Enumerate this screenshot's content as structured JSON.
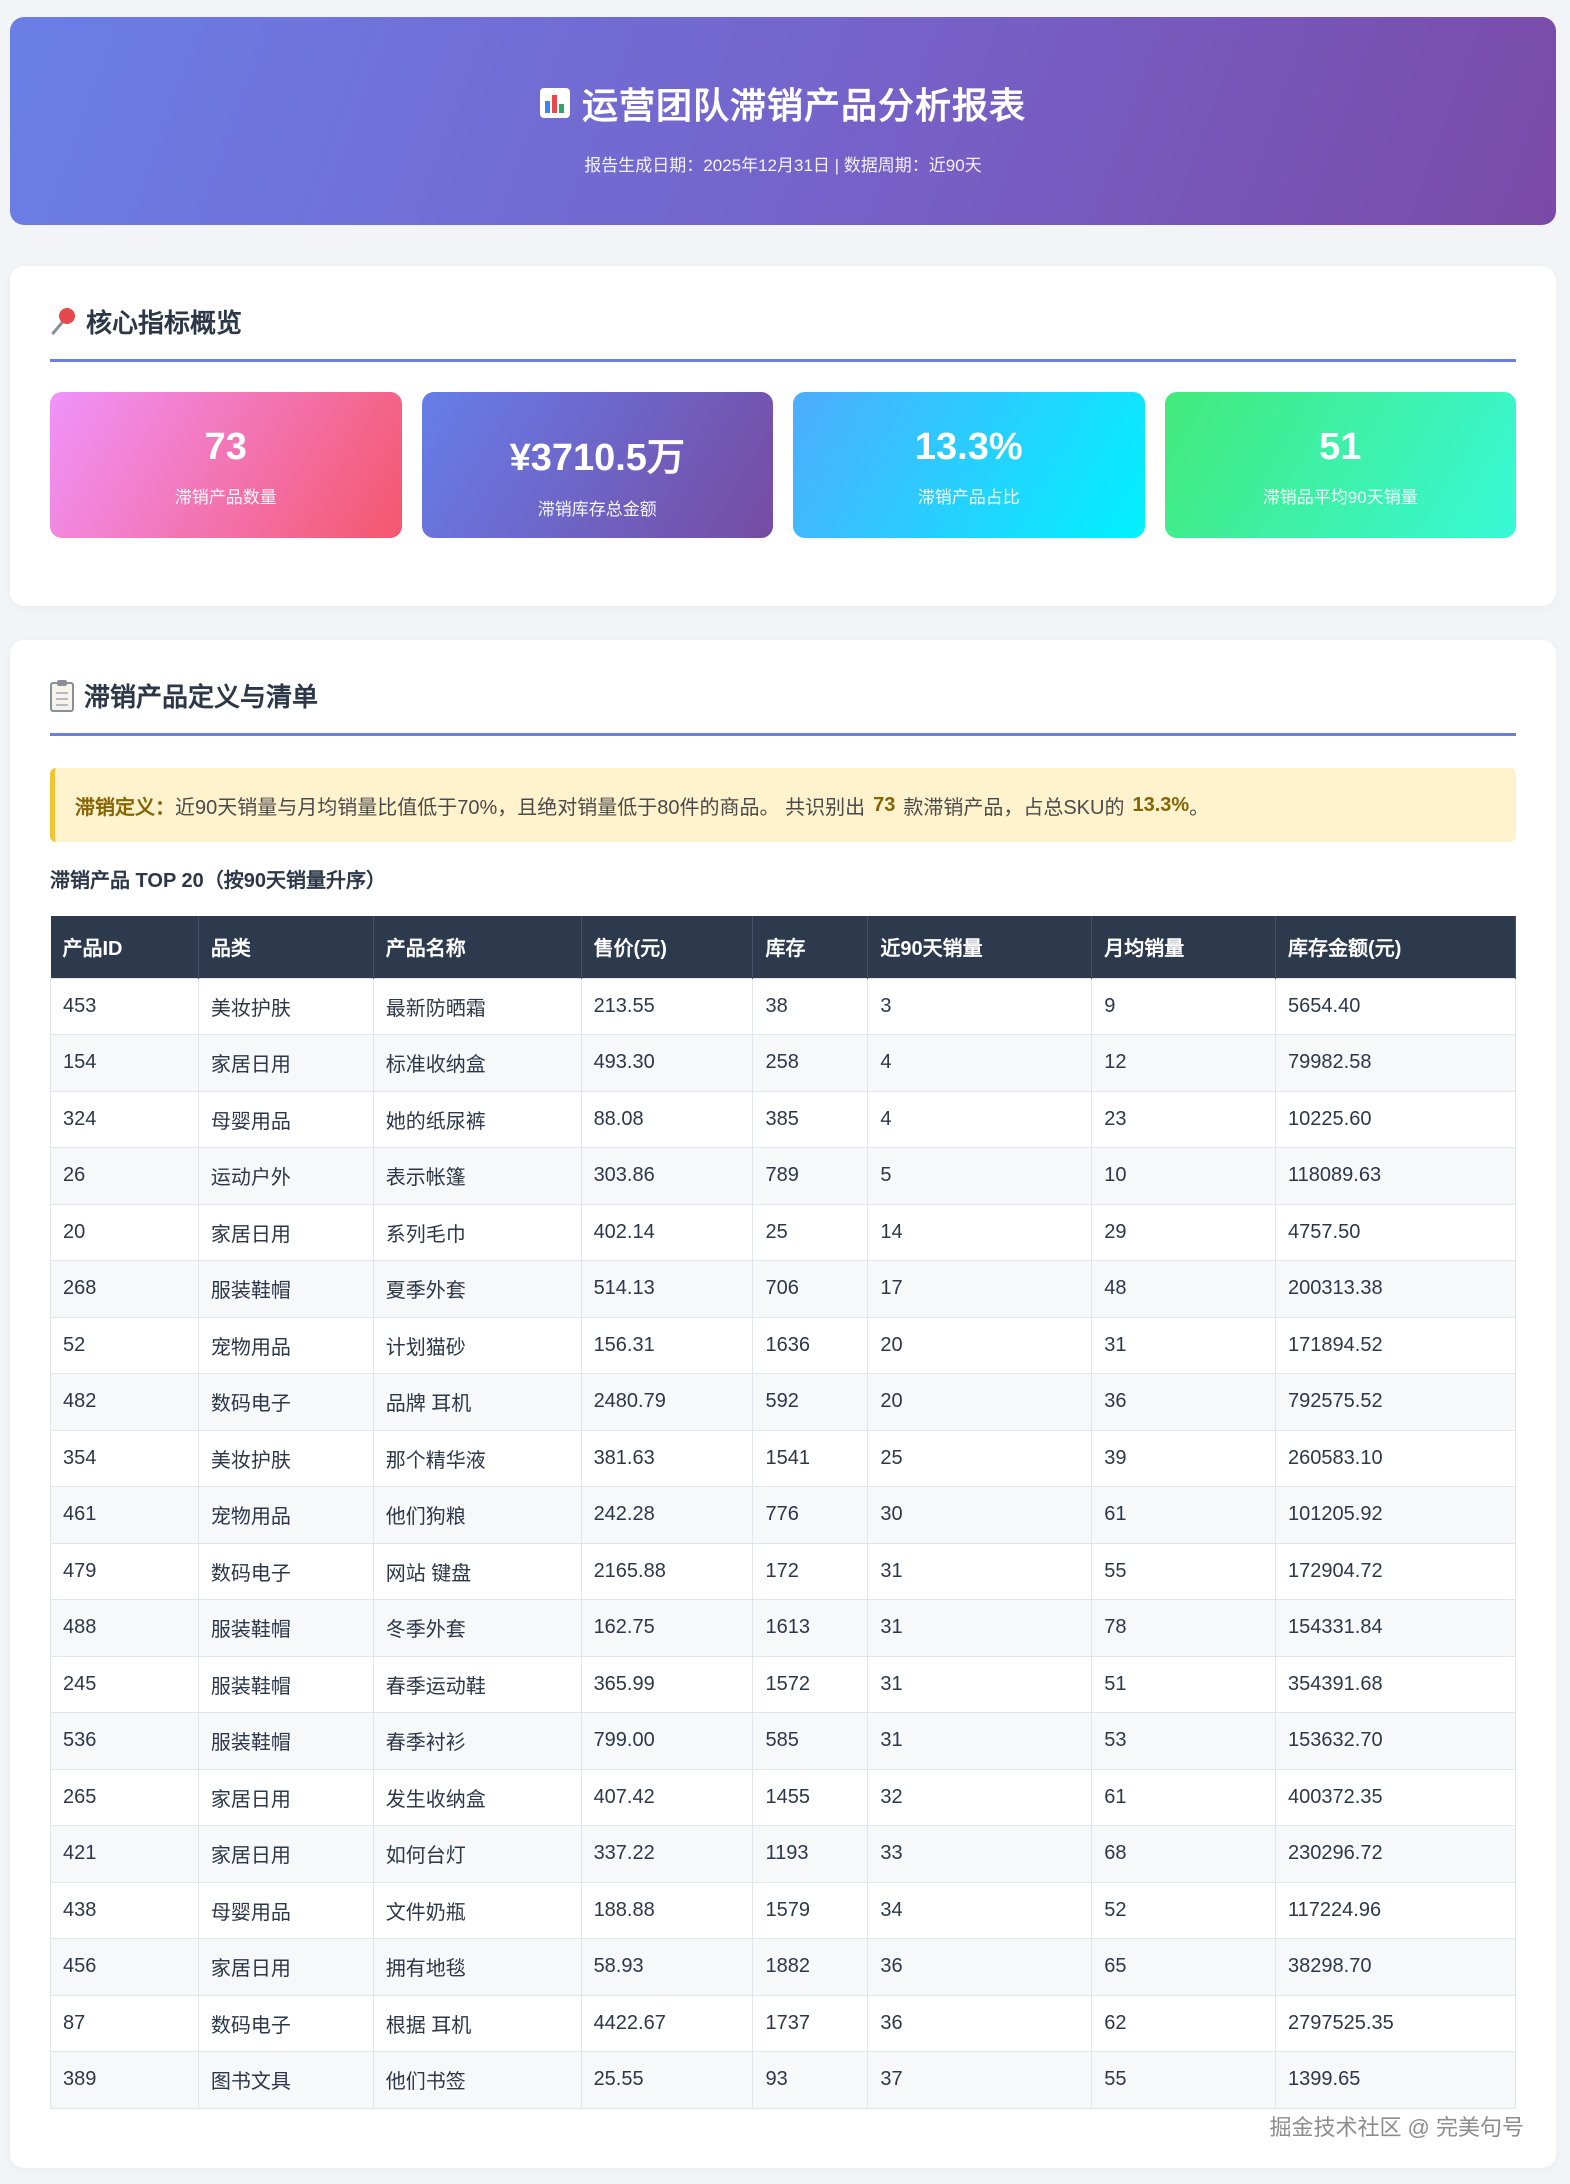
{
  "header": {
    "title": "运营团队滞销产品分析报表",
    "subtitle": "报告生成日期：2025年12月31日 | 数据周期：近90天",
    "icon": "bar-chart-icon"
  },
  "overview": {
    "title": "核心指标概览",
    "icon": "pushpin-icon",
    "metrics": [
      {
        "value": "73",
        "label": "滞销产品数量"
      },
      {
        "value": "¥3710.5万",
        "label": "滞销库存总金额"
      },
      {
        "value": "13.3%",
        "label": "滞销产品占比"
      },
      {
        "value": "51",
        "label": "滞销品平均90天销量"
      }
    ]
  },
  "list_section": {
    "title": "滞销产品定义与清单",
    "icon": "clipboard-icon",
    "note": {
      "key": "滞销定义：",
      "text1": "近90天销量与月均销量比值低于70%，且绝对销量低于80件的商品。 共识别出",
      "count": "73",
      "text2": "款滞销产品，占总SKU的",
      "percent": "13.3%",
      "text3": "。"
    },
    "table_title": "滞销产品 TOP 20（按90天销量升序）",
    "columns": [
      "产品ID",
      "品类",
      "产品名称",
      "售价(元)",
      "库存",
      "近90天销量",
      "月均销量",
      "库存金额(元)"
    ],
    "rows": [
      [
        "453",
        "美妆护肤",
        "最新防晒霜",
        "213.55",
        "38",
        "3",
        "9",
        "5654.40"
      ],
      [
        "154",
        "家居日用",
        "标准收纳盒",
        "493.30",
        "258",
        "4",
        "12",
        "79982.58"
      ],
      [
        "324",
        "母婴用品",
        "她的纸尿裤",
        "88.08",
        "385",
        "4",
        "23",
        "10225.60"
      ],
      [
        "26",
        "运动户外",
        "表示帐篷",
        "303.86",
        "789",
        "5",
        "10",
        "118089.63"
      ],
      [
        "20",
        "家居日用",
        "系列毛巾",
        "402.14",
        "25",
        "14",
        "29",
        "4757.50"
      ],
      [
        "268",
        "服装鞋帽",
        "夏季外套",
        "514.13",
        "706",
        "17",
        "48",
        "200313.38"
      ],
      [
        "52",
        "宠物用品",
        "计划猫砂",
        "156.31",
        "1636",
        "20",
        "31",
        "171894.52"
      ],
      [
        "482",
        "数码电子",
        "品牌 耳机",
        "2480.79",
        "592",
        "20",
        "36",
        "792575.52"
      ],
      [
        "354",
        "美妆护肤",
        "那个精华液",
        "381.63",
        "1541",
        "25",
        "39",
        "260583.10"
      ],
      [
        "461",
        "宠物用品",
        "他们狗粮",
        "242.28",
        "776",
        "30",
        "61",
        "101205.92"
      ],
      [
        "479",
        "数码电子",
        "网站 键盘",
        "2165.88",
        "172",
        "31",
        "55",
        "172904.72"
      ],
      [
        "488",
        "服装鞋帽",
        "冬季外套",
        "162.75",
        "1613",
        "31",
        "78",
        "154331.84"
      ],
      [
        "245",
        "服装鞋帽",
        "春季运动鞋",
        "365.99",
        "1572",
        "31",
        "51",
        "354391.68"
      ],
      [
        "536",
        "服装鞋帽",
        "春季衬衫",
        "799.00",
        "585",
        "31",
        "53",
        "153632.70"
      ],
      [
        "265",
        "家居日用",
        "发生收纳盒",
        "407.42",
        "1455",
        "32",
        "61",
        "400372.35"
      ],
      [
        "421",
        "家居日用",
        "如何台灯",
        "337.22",
        "1193",
        "33",
        "68",
        "230296.72"
      ],
      [
        "438",
        "母婴用品",
        "文件奶瓶",
        "188.88",
        "1579",
        "34",
        "52",
        "117224.96"
      ],
      [
        "456",
        "家居日用",
        "拥有地毯",
        "58.93",
        "1882",
        "36",
        "65",
        "38298.70"
      ],
      [
        "87",
        "数码电子",
        "根据 耳机",
        "4422.67",
        "1737",
        "36",
        "62",
        "2797525.35"
      ],
      [
        "389",
        "图书文具",
        "他们书签",
        "25.55",
        "93",
        "37",
        "55",
        "1399.65"
      ]
    ]
  },
  "watermark": "掘金技术社区 @ 完美句号"
}
